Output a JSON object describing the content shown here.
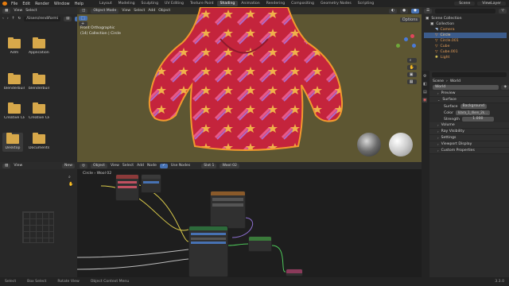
{
  "topbar": {
    "menu": [
      "File",
      "Edit",
      "Render",
      "Window",
      "Help"
    ],
    "workspaces": [
      "Layout",
      "Modeling",
      "Sculpting",
      "UV Editing",
      "Texture Paint",
      "Shading",
      "Animation",
      "Rendering",
      "Compositing",
      "Geometry Nodes",
      "Scripting"
    ],
    "active_workspace": "Shading",
    "scene": "Scene",
    "view_layer": "ViewLayer"
  },
  "file_browser": {
    "menu": [
      "View",
      "Select"
    ],
    "path": "/Users/rendiformi",
    "items": [
      "Adm",
      "Applications",
      "blenderbuild",
      "blenderbuild_lit...",
      "Creative Clo...",
      "Creative Clo...",
      "Desktop",
      "Documents"
    ]
  },
  "viewport": {
    "mode": "Object Mode",
    "menu": [
      "View",
      "Select",
      "Add",
      "Object"
    ],
    "orientation": "Global",
    "title": "Front Orthographic",
    "subtitle": "(14) Collection | Circle",
    "options": "Options"
  },
  "outliner": {
    "title": "Scene Collection",
    "rows": [
      "Collection",
      "Camera",
      "Circle",
      "Circle.001",
      "Cube",
      "Cube.001",
      "Light"
    ]
  },
  "properties": {
    "scene": "Scene",
    "world_tab": "World",
    "world_name": "World",
    "panels": [
      "Preview",
      "Surface",
      "Volume",
      "Ray Visibility",
      "Settings",
      "Viewport Display",
      "Custom Properties"
    ],
    "surface_label": "Surface",
    "surface_value": "Background",
    "color_label": "Color",
    "color_value": "klara_1_4ken_2k...",
    "strength_label": "Strength",
    "strength_value": "1.000"
  },
  "node_editor": {
    "mode": "Object",
    "menu": [
      "View",
      "Select",
      "Add",
      "Node"
    ],
    "use_nodes": "Use Nodes",
    "slot": "Slot 1",
    "material": "Wool 02",
    "new_label": "New"
  },
  "left_editor": {
    "menu": [
      "View"
    ],
    "node_title": "Circle",
    "node_title2": "Wool 02"
  },
  "statusbar": [
    "Select",
    "Box Select",
    "Rotate View",
    "Object Context Menu"
  ],
  "version": "3.3.0",
  "colors": {
    "accent": "#4772b3",
    "viewport_bg": "#5d5632",
    "fabric": "#c4243c",
    "star": "#f0b24a",
    "folder": "#d7a84a"
  }
}
